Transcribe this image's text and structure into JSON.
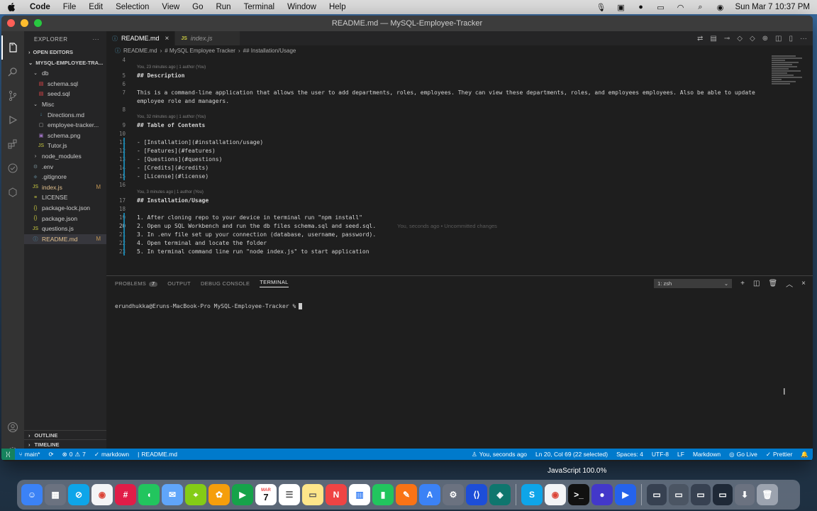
{
  "menubar": {
    "app": "Code",
    "items": [
      "File",
      "Edit",
      "Selection",
      "View",
      "Go",
      "Run",
      "Terminal",
      "Window",
      "Help"
    ],
    "clock": "Sun Mar 7  10:37 PM"
  },
  "window": {
    "title": "README.md — MySQL-Employee-Tracker"
  },
  "sidebar": {
    "header": "EXPLORER",
    "open_editors": "OPEN EDITORS",
    "project": "MYSQL-EMPLOYEE-TRA...",
    "items": [
      {
        "label": "db",
        "icon": "chevron-down",
        "indent": 1
      },
      {
        "label": "schema.sql",
        "icon": "database-icon",
        "indent": 2
      },
      {
        "label": "seed.sql",
        "icon": "database-icon",
        "indent": 2
      },
      {
        "label": "Misc",
        "icon": "chevron-down",
        "indent": 1
      },
      {
        "label": "Directions.md",
        "icon": "markdown-icon",
        "indent": 2
      },
      {
        "label": "employee-tracker...",
        "icon": "file-icon",
        "indent": 2
      },
      {
        "label": "schema.png",
        "icon": "image-icon",
        "indent": 2
      },
      {
        "label": "Tutor.js",
        "icon": "js-icon",
        "indent": 2
      },
      {
        "label": "node_modules",
        "icon": "chevron-right",
        "indent": 1
      },
      {
        "label": ".env",
        "icon": "gear-icon",
        "indent": 1
      },
      {
        "label": ".gitignore",
        "icon": "git-icon",
        "indent": 1
      },
      {
        "label": "index.js",
        "icon": "js-icon",
        "indent": 1,
        "badge": "M"
      },
      {
        "label": "LICENSE",
        "icon": "license-icon",
        "indent": 1
      },
      {
        "label": "package-lock.json",
        "icon": "json-icon",
        "indent": 1
      },
      {
        "label": "package.json",
        "icon": "json-icon",
        "indent": 1
      },
      {
        "label": "questions.js",
        "icon": "js-icon",
        "indent": 1
      },
      {
        "label": "README.md",
        "icon": "info-icon",
        "indent": 1,
        "badge": "M",
        "selected": true
      }
    ],
    "outline": "OUTLINE",
    "timeline": "TIMELINE"
  },
  "tabs": [
    {
      "label": "README.md",
      "active": true
    },
    {
      "label": "index.js",
      "active": false
    }
  ],
  "breadcrumb": [
    "README.md",
    "# MySQL Employee Tracker",
    "## Installation/Usage"
  ],
  "code": {
    "lines": [
      {
        "n": "4",
        "text": ""
      },
      {
        "n": "5",
        "text": "## Description",
        "lens": "You, 23 minutes ago | 1 author (You)"
      },
      {
        "n": "6",
        "text": ""
      },
      {
        "n": "7",
        "text": "This is a command-line application that allows the user to add departments, roles, employees. They can view these departments, roles, and employees employees. Also be able to update"
      },
      {
        "n": "",
        "text": "employee role and managers."
      },
      {
        "n": "8",
        "text": ""
      },
      {
        "n": "9",
        "text": "## Table of Contents",
        "lens": "You, 32 minutes ago | 1 author (You)"
      },
      {
        "n": "10",
        "text": ""
      },
      {
        "n": "11",
        "text": "- [Installation](#installation/usage)"
      },
      {
        "n": "12",
        "text": "- [Features](#features)"
      },
      {
        "n": "13",
        "text": "- [Questions](#questions)"
      },
      {
        "n": "14",
        "text": "- [Credits](#credits)"
      },
      {
        "n": "15",
        "text": "- [License](#license)"
      },
      {
        "n": "16",
        "text": ""
      },
      {
        "n": "17",
        "text": "## Installation/Usage",
        "lens": "You, 3 minutes ago | 1 author (You)"
      },
      {
        "n": "18",
        "text": ""
      },
      {
        "n": "19",
        "text": "1. After cloning repo to your device in terminal run \"npm install\""
      },
      {
        "n": "20",
        "text": "2. Open up SQL Workbench and run the db files schema.sql and seed.sql.",
        "blame": "You, seconds ago • Uncommitted changes"
      },
      {
        "n": "21",
        "text": "3. In .env file set up your connection (database, username, password)."
      },
      {
        "n": "22",
        "text": "4. Open terminal and locate the folder"
      },
      {
        "n": "23",
        "text": "5. In terminal command line run \"node index.js\" to start application"
      }
    ]
  },
  "panel": {
    "tabs": [
      "PROBLEMS",
      "OUTPUT",
      "DEBUG CONSOLE",
      "TERMINAL"
    ],
    "problems_count": "7",
    "terminal_select": "1: zsh",
    "prompt": "erundhukka@Eruns-MacBook-Pro MySQL-Employee-Tracker %"
  },
  "statusbar": {
    "branch": "main*",
    "errors": "0",
    "warnings": "7",
    "markdown": "markdown",
    "file": "README.md",
    "blame": "You, seconds ago",
    "position": "Ln 20, Col 69 (22 selected)",
    "spaces": "Spaces: 4",
    "encoding": "UTF-8",
    "eol": "LF",
    "language": "Markdown",
    "golive": "Go Live",
    "prettier": "Prettier"
  },
  "desktop": {
    "js_badge": "JavaScript 100.0%"
  },
  "dock": {
    "calendar_month": "MAR",
    "calendar_day": "7"
  },
  "colors": {
    "accent": "#007acc",
    "editor_bg": "#1e1e1e",
    "sidebar_bg": "#252526",
    "heading": "#569cd6",
    "modified": "#e2c08d"
  }
}
